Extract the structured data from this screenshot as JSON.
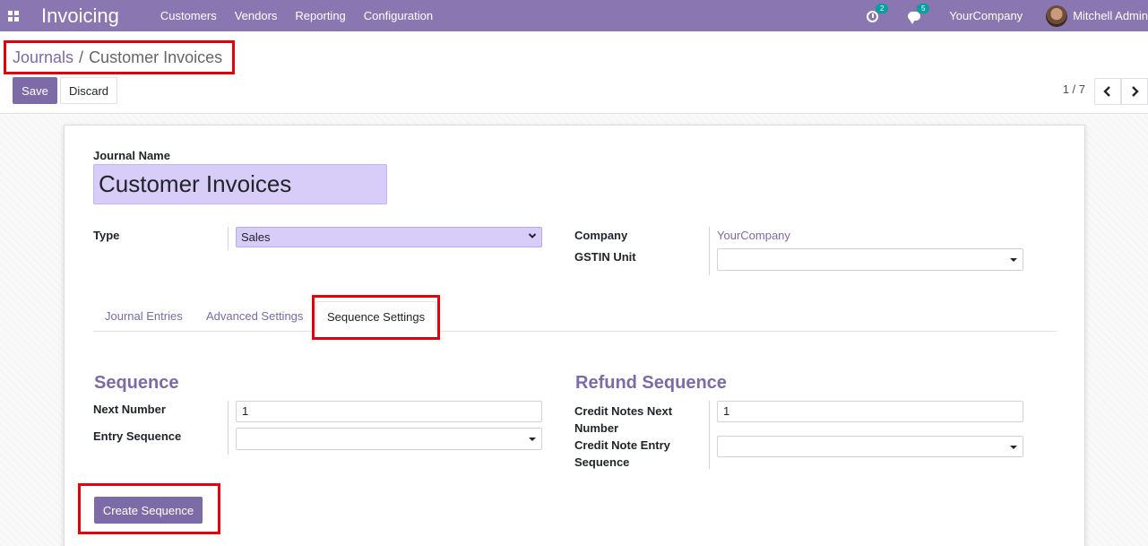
{
  "navbar": {
    "app_icon": "apps-grid-icon",
    "brand": "Invoicing",
    "menu": [
      "Customers",
      "Vendors",
      "Reporting",
      "Configuration"
    ],
    "activity_badge": "2",
    "messages_badge": "5",
    "company": "YourCompany",
    "user": "Mitchell Admin"
  },
  "breadcrumb": {
    "parent": "Journals",
    "separator": "/",
    "current": "Customer Invoices"
  },
  "actions": {
    "save_label": "Save",
    "discard_label": "Discard"
  },
  "pager": {
    "value": "1 / 7",
    "prev_icon": "chevron-left-icon",
    "next_icon": "chevron-right-icon"
  },
  "form": {
    "journal_name_label": "Journal Name",
    "journal_name": "Customer Invoices",
    "type_label": "Type",
    "type_value": "Sales",
    "company_label": "Company",
    "company_value": "YourCompany",
    "gstin_label": "GSTIN Unit",
    "gstin_value": ""
  },
  "tabs": [
    {
      "label": "Journal Entries",
      "active": false
    },
    {
      "label": "Advanced Settings",
      "active": false
    },
    {
      "label": "Sequence Settings",
      "active": true
    }
  ],
  "sequence": {
    "title": "Sequence",
    "next_number_label": "Next Number",
    "next_number": "1",
    "entry_sequence_label": "Entry Sequence",
    "entry_sequence": ""
  },
  "refund": {
    "title": "Refund Sequence",
    "credit_next_label_1": "Credit Notes Next",
    "credit_next_label_2": "Number",
    "credit_next": "1",
    "credit_entry_label_1": "Credit Note Entry",
    "credit_entry_label_2": "Sequence",
    "credit_entry": ""
  },
  "create_sequence_label": "Create Sequence",
  "colors": {
    "navbar": "#8a76b0",
    "accent": "#7c6ba6",
    "highlight": "#e3000b",
    "required_field": "#d8ccf8"
  }
}
